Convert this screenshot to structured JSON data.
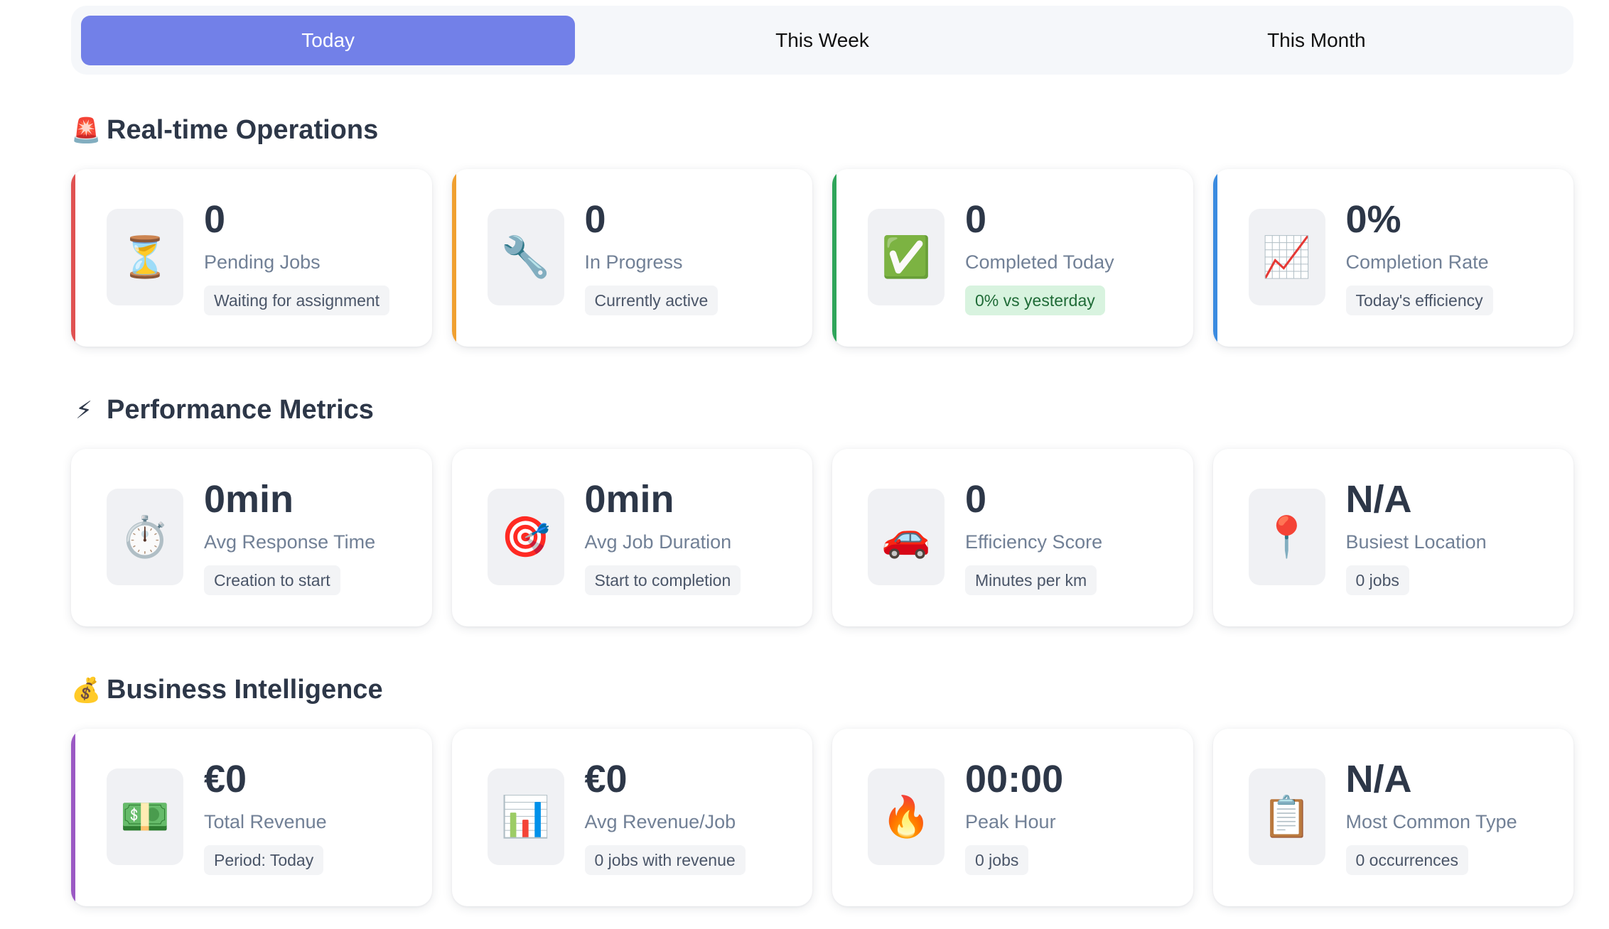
{
  "tabs": [
    {
      "label": "Today",
      "active": true
    },
    {
      "label": "This Week",
      "active": false
    },
    {
      "label": "This Month",
      "active": false
    }
  ],
  "sections": [
    {
      "title": "Real-time Operations",
      "icon": "🚨",
      "icon_name": "siren-icon",
      "cards": [
        {
          "value": "0",
          "label": "Pending Jobs",
          "badge": "Waiting for assignment",
          "icon": "⏳",
          "icon_name": "hourglass-icon",
          "accent": "#e05252",
          "badge_style": "gray"
        },
        {
          "value": "0",
          "label": "In Progress",
          "badge": "Currently active",
          "icon": "🔧",
          "icon_name": "wrench-icon",
          "accent": "#f0a030",
          "badge_style": "gray"
        },
        {
          "value": "0",
          "label": "Completed Today",
          "badge": "0% vs yesterday",
          "icon": "✅",
          "icon_name": "check-mark-icon",
          "accent": "#2fa55a",
          "badge_style": "green"
        },
        {
          "value": "0%",
          "label": "Completion Rate",
          "badge": "Today's efficiency",
          "icon": "📈",
          "icon_name": "chart-increasing-icon",
          "accent": "#3a8be0",
          "badge_style": "gray"
        }
      ]
    },
    {
      "title": "Performance Metrics",
      "icon": "⚡",
      "icon_name": "lightning-icon",
      "cards": [
        {
          "value": "0min",
          "label": "Avg Response Time",
          "badge": "Creation to start",
          "icon": "⏱️",
          "icon_name": "stopwatch-icon",
          "accent": "",
          "badge_style": "gray"
        },
        {
          "value": "0min",
          "label": "Avg Job Duration",
          "badge": "Start to completion",
          "icon": "🎯",
          "icon_name": "target-icon",
          "accent": "",
          "badge_style": "gray"
        },
        {
          "value": "0",
          "label": "Efficiency Score",
          "badge": "Minutes per km",
          "icon": "🚗",
          "icon_name": "car-icon",
          "accent": "",
          "badge_style": "gray"
        },
        {
          "value": "N/A",
          "label": "Busiest Location",
          "badge": "0 jobs",
          "icon": "📍",
          "icon_name": "pin-icon",
          "accent": "",
          "badge_style": "gray"
        }
      ]
    },
    {
      "title": "Business Intelligence",
      "icon": "💰",
      "icon_name": "money-bag-icon",
      "cards": [
        {
          "value": "€0",
          "label": "Total Revenue",
          "badge": "Period: Today",
          "icon": "💵",
          "icon_name": "banknote-icon",
          "accent": "#9b59c4",
          "badge_style": "gray"
        },
        {
          "value": "€0",
          "label": "Avg Revenue/Job",
          "badge": "0 jobs with revenue",
          "icon": "📊",
          "icon_name": "bar-chart-icon",
          "accent": "",
          "badge_style": "gray"
        },
        {
          "value": "00:00",
          "label": "Peak Hour",
          "badge": "0 jobs",
          "icon": "🔥",
          "icon_name": "fire-icon",
          "accent": "",
          "badge_style": "gray"
        },
        {
          "value": "N/A",
          "label": "Most Common Type",
          "badge": "0 occurrences",
          "icon": "📋",
          "icon_name": "clipboard-icon",
          "accent": "",
          "badge_style": "gray"
        }
      ]
    }
  ]
}
